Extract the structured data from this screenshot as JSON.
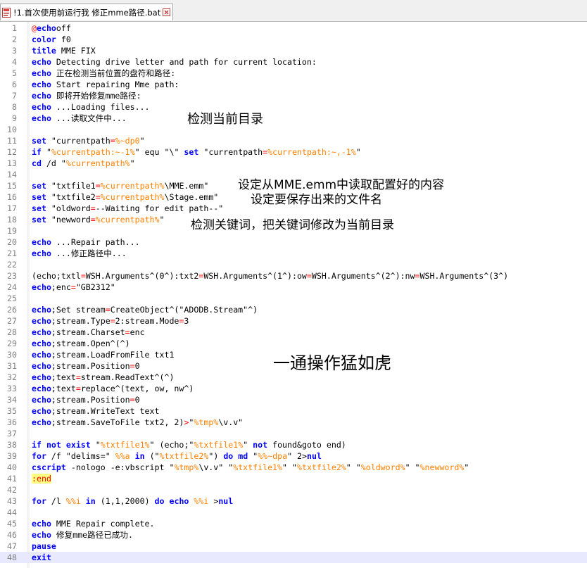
{
  "tab": {
    "title": "!1.首次使用前运行我 修正mme路径.bat",
    "file_icon": "bat-file-icon",
    "close_icon": "close-icon"
  },
  "lines": [
    {
      "n": "1",
      "t": [
        [
          "at",
          "@"
        ],
        [
          "kw",
          "echo"
        ],
        [
          "",
          "off"
        ]
      ]
    },
    {
      "n": "2",
      "t": [
        [
          "kw",
          "color"
        ],
        [
          "",
          " f0"
        ]
      ]
    },
    {
      "n": "3",
      "t": [
        [
          "kw",
          "title"
        ],
        [
          "",
          " MME FIX"
        ]
      ]
    },
    {
      "n": "4",
      "t": [
        [
          "kw",
          "echo"
        ],
        [
          "",
          " Detecting drive letter and path for current location:"
        ]
      ]
    },
    {
      "n": "5",
      "t": [
        [
          "kw",
          "echo"
        ],
        [
          "",
          " 正在检测当前位置的盘符和路径:"
        ]
      ]
    },
    {
      "n": "6",
      "t": [
        [
          "kw",
          "echo"
        ],
        [
          "",
          " Start repairing Mme path:"
        ]
      ]
    },
    {
      "n": "7",
      "t": [
        [
          "kw",
          "echo"
        ],
        [
          "",
          " 即将开始修复mme路径:"
        ]
      ]
    },
    {
      "n": "8",
      "t": [
        [
          "kw",
          "echo"
        ],
        [
          "",
          " ...Loading files..."
        ]
      ]
    },
    {
      "n": "9",
      "t": [
        [
          "kw",
          "echo"
        ],
        [
          "",
          " ...读取文件中..."
        ]
      ]
    },
    {
      "n": "10",
      "t": []
    },
    {
      "n": "11",
      "t": [
        [
          "kw",
          "set"
        ],
        [
          "",
          " \"currentpath"
        ],
        [
          "op",
          "="
        ],
        [
          "var",
          "%~dp0"
        ],
        [
          "",
          "\""
        ]
      ]
    },
    {
      "n": "12",
      "t": [
        [
          "kw",
          "if"
        ],
        [
          "",
          " \""
        ],
        [
          "var",
          "%currentpath:~-1%"
        ],
        [
          "",
          "\" equ \"\\\" "
        ],
        [
          "kw",
          "set"
        ],
        [
          "",
          " \"currentpath"
        ],
        [
          "op",
          "="
        ],
        [
          "var",
          "%currentpath:~,-1%"
        ],
        [
          "",
          "\""
        ]
      ]
    },
    {
      "n": "13",
      "t": [
        [
          "kw",
          "cd"
        ],
        [
          "",
          " /d \""
        ],
        [
          "var",
          "%currentpath%"
        ],
        [
          "",
          "\""
        ]
      ]
    },
    {
      "n": "14",
      "t": []
    },
    {
      "n": "15",
      "t": [
        [
          "kw",
          "set"
        ],
        [
          "",
          " \"txtfile1"
        ],
        [
          "op",
          "="
        ],
        [
          "var",
          "%currentpath%"
        ],
        [
          "",
          "\\MME.emm\""
        ]
      ]
    },
    {
      "n": "16",
      "t": [
        [
          "kw",
          "set"
        ],
        [
          "",
          " \"txtfile2"
        ],
        [
          "op",
          "="
        ],
        [
          "var",
          "%currentpath%"
        ],
        [
          "",
          "\\Stage.emm\""
        ]
      ]
    },
    {
      "n": "17",
      "t": [
        [
          "kw",
          "set"
        ],
        [
          "",
          " \"oldword"
        ],
        [
          "op",
          "="
        ],
        [
          "",
          "--Waiting for edit path--\""
        ]
      ]
    },
    {
      "n": "18",
      "t": [
        [
          "kw",
          "set"
        ],
        [
          "",
          " \"newword"
        ],
        [
          "op",
          "="
        ],
        [
          "var",
          "%currentpath%"
        ],
        [
          "",
          "\""
        ]
      ]
    },
    {
      "n": "19",
      "t": []
    },
    {
      "n": "20",
      "t": [
        [
          "kw",
          "echo"
        ],
        [
          "",
          " ...Repair path..."
        ]
      ]
    },
    {
      "n": "21",
      "t": [
        [
          "kw",
          "echo"
        ],
        [
          "",
          " ...修正路径中..."
        ]
      ]
    },
    {
      "n": "22",
      "t": []
    },
    {
      "n": "23",
      "t": [
        [
          "",
          "(echo;txtl"
        ],
        [
          "op",
          "="
        ],
        [
          "",
          "WSH.Arguments^(0^):txt2"
        ],
        [
          "op",
          "="
        ],
        [
          "",
          "WSH.Arguments^(1^):ow"
        ],
        [
          "op",
          "="
        ],
        [
          "",
          "WSH.Arguments^(2^):nw"
        ],
        [
          "op",
          "="
        ],
        [
          "",
          "WSH.Arguments^(3^)"
        ]
      ]
    },
    {
      "n": "24",
      "t": [
        [
          "kw",
          "echo"
        ],
        [
          "",
          ";enc"
        ],
        [
          "op",
          "="
        ],
        [
          "",
          "\"GB2312\""
        ]
      ]
    },
    {
      "n": "25",
      "t": []
    },
    {
      "n": "26",
      "t": [
        [
          "kw",
          "echo"
        ],
        [
          "",
          ";Set stream"
        ],
        [
          "op",
          "="
        ],
        [
          "",
          "CreateObject^(\"ADODB.Stream\"^)"
        ]
      ]
    },
    {
      "n": "27",
      "t": [
        [
          "kw",
          "echo"
        ],
        [
          "",
          ";stream.Type"
        ],
        [
          "op",
          "="
        ],
        [
          "",
          "2:stream.Mode"
        ],
        [
          "op",
          "="
        ],
        [
          "",
          "3"
        ]
      ]
    },
    {
      "n": "28",
      "t": [
        [
          "kw",
          "echo"
        ],
        [
          "",
          ";stream.Charset"
        ],
        [
          "op",
          "="
        ],
        [
          "",
          "enc"
        ]
      ]
    },
    {
      "n": "29",
      "t": [
        [
          "kw",
          "echo"
        ],
        [
          "",
          ";stream.Open^(^)"
        ]
      ]
    },
    {
      "n": "30",
      "t": [
        [
          "kw",
          "echo"
        ],
        [
          "",
          ";stream.LoadFromFile txt1"
        ]
      ]
    },
    {
      "n": "31",
      "t": [
        [
          "kw",
          "echo"
        ],
        [
          "",
          ";stream.Position"
        ],
        [
          "op",
          "="
        ],
        [
          "",
          "0"
        ]
      ]
    },
    {
      "n": "32",
      "t": [
        [
          "kw",
          "echo"
        ],
        [
          "",
          ";text"
        ],
        [
          "op",
          "="
        ],
        [
          "",
          "stream.ReadText^(^)"
        ]
      ]
    },
    {
      "n": "33",
      "t": [
        [
          "kw",
          "echo"
        ],
        [
          "",
          ";text"
        ],
        [
          "op",
          "="
        ],
        [
          "",
          "replace^(text, ow, nw^)"
        ]
      ]
    },
    {
      "n": "34",
      "t": [
        [
          "kw",
          "echo"
        ],
        [
          "",
          ";stream.Position"
        ],
        [
          "op",
          "="
        ],
        [
          "",
          "0"
        ]
      ]
    },
    {
      "n": "35",
      "t": [
        [
          "kw",
          "echo"
        ],
        [
          "",
          ";stream.WriteText text"
        ]
      ]
    },
    {
      "n": "36",
      "t": [
        [
          "kw",
          "echo"
        ],
        [
          "",
          ";stream.SaveToFile txt2, 2)"
        ],
        [
          "op",
          ">"
        ],
        [
          "",
          "\""
        ],
        [
          "var",
          "%tmp%"
        ],
        [
          "",
          "\\v.v\""
        ]
      ]
    },
    {
      "n": "37",
      "t": []
    },
    {
      "n": "38",
      "t": [
        [
          "kw",
          "if not exist"
        ],
        [
          "",
          " \""
        ],
        [
          "var",
          "%txtfile1%"
        ],
        [
          "",
          "\" (echo;\""
        ],
        [
          "var",
          "%txtfile1%"
        ],
        [
          "",
          "\" "
        ],
        [
          "kw",
          "not"
        ],
        [
          "",
          " found&goto end)"
        ]
      ]
    },
    {
      "n": "39",
      "t": [
        [
          "kw",
          "for"
        ],
        [
          "",
          " /f \"delims=\" "
        ],
        [
          "var",
          "%%a"
        ],
        [
          "",
          ""
        ],
        [
          "kw",
          " in"
        ],
        [
          "",
          " (\""
        ],
        [
          "var",
          "%txtfile2%"
        ],
        [
          "",
          "\") "
        ],
        [
          "kw",
          "do"
        ],
        [
          "",
          ""
        ],
        [
          "kw",
          " md"
        ],
        [
          "",
          " \""
        ],
        [
          "var",
          "%%~dpa"
        ],
        [
          "",
          "\" 2>"
        ],
        [
          "kw",
          "nul"
        ]
      ]
    },
    {
      "n": "40",
      "t": [
        [
          "kw",
          "cscript"
        ],
        [
          "",
          " -nologo -e:vbscript \""
        ],
        [
          "var",
          "%tmp%"
        ],
        [
          "",
          "\\v.v\" \""
        ],
        [
          "var",
          "%txtfile1%"
        ],
        [
          "",
          "\" \""
        ],
        [
          "var",
          "%txtfile2%"
        ],
        [
          "",
          "\" \""
        ],
        [
          "var",
          "%oldword%"
        ],
        [
          "",
          "\" \""
        ],
        [
          "var",
          "%newword%"
        ],
        [
          "",
          "\""
        ]
      ]
    },
    {
      "n": "41",
      "t": [
        [
          "label",
          ":end"
        ]
      ]
    },
    {
      "n": "42",
      "t": []
    },
    {
      "n": "43",
      "t": [
        [
          "kw",
          "for"
        ],
        [
          "",
          " /l "
        ],
        [
          "var",
          "%%i"
        ],
        [
          "",
          ""
        ],
        [
          "kw",
          " in"
        ],
        [
          "",
          " (1,1,2000) "
        ],
        [
          "kw",
          "do"
        ],
        [
          "",
          ""
        ],
        [
          "kw",
          " echo"
        ],
        [
          "",
          " "
        ],
        [
          "var",
          "%%i"
        ],
        [
          "",
          " >"
        ],
        [
          "kw",
          "nul"
        ]
      ]
    },
    {
      "n": "44",
      "t": []
    },
    {
      "n": "45",
      "t": [
        [
          "kw",
          "echo"
        ],
        [
          "",
          " MME Repair complete."
        ]
      ]
    },
    {
      "n": "46",
      "t": [
        [
          "kw",
          "echo"
        ],
        [
          "",
          " 修复mme路径已成功."
        ]
      ]
    },
    {
      "n": "47",
      "t": [
        [
          "kw",
          "pause"
        ]
      ]
    },
    {
      "n": "48",
      "t": [
        [
          "kw",
          "exit"
        ]
      ]
    }
  ],
  "annotations": {
    "detect_dir": "检测当前目录",
    "read_config": "设定从MME.emm中读取配置好的内容",
    "save_file": "设定要保存出来的文件名",
    "replace_keyword": "检测关键词，把关键词修改为当前目录",
    "operation": "一通操作猛如虎"
  }
}
